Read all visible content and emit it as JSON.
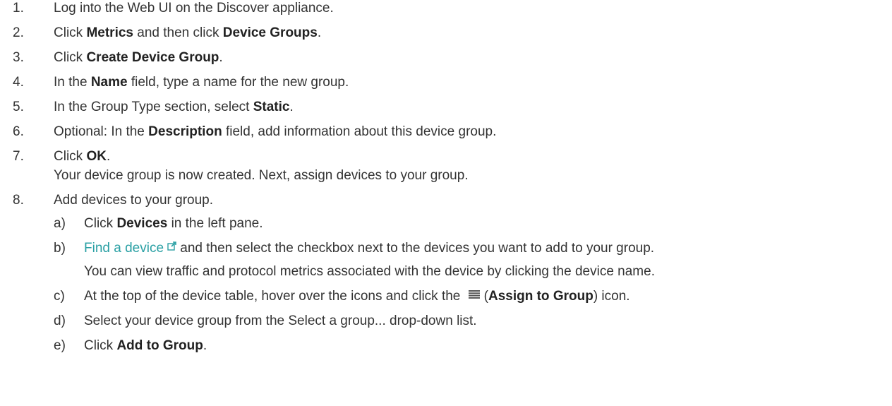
{
  "steps": [
    {
      "num": "1.",
      "parts": [
        "Log into the Web UI on the Discover appliance."
      ]
    },
    {
      "num": "2.",
      "parts": [
        "Click ",
        "Metrics",
        " and then click ",
        "Device Groups",
        "."
      ]
    },
    {
      "num": "3.",
      "parts": [
        "Click ",
        "Create Device Group",
        "."
      ]
    },
    {
      "num": "4.",
      "parts": [
        "In the ",
        "Name",
        " field, type a name for the new group."
      ]
    },
    {
      "num": "5.",
      "parts": [
        "In the Group Type section, select ",
        "Static",
        "."
      ]
    },
    {
      "num": "6.",
      "parts": [
        "Optional: In the ",
        "Description",
        " field, add information about this device group."
      ]
    },
    {
      "num": "7.",
      "parts": [
        "Click ",
        "OK",
        "."
      ],
      "result": "Your device group is now created. Next, assign devices to your group."
    },
    {
      "num": "8.",
      "parts": [
        "Add devices to your group."
      ],
      "substeps": [
        {
          "num": "a)",
          "parts": [
            "Click ",
            "Devices",
            " in the left pane."
          ]
        },
        {
          "num": "b)",
          "link": "Find a device",
          "parts": [
            " and then select the checkbox next to the devices you want to add to your group."
          ],
          "info": "You can view traffic and protocol metrics associated with the device by clicking the device name."
        },
        {
          "num": "c)",
          "parts": [
            "At the top of the device table, hover over the icons and click the ",
            "(",
            "Assign to Group",
            ") icon."
          ]
        },
        {
          "num": "d)",
          "parts": [
            "Select your device group from the Select a group... drop-down list."
          ]
        },
        {
          "num": "e)",
          "parts": [
            "Click ",
            "Add to Group",
            "."
          ]
        }
      ]
    }
  ],
  "colors": {
    "text": "#333333",
    "link": "#2aa0a4"
  },
  "icons": {
    "external_link": "external-link-icon",
    "assign_to_group": "list-icon"
  }
}
